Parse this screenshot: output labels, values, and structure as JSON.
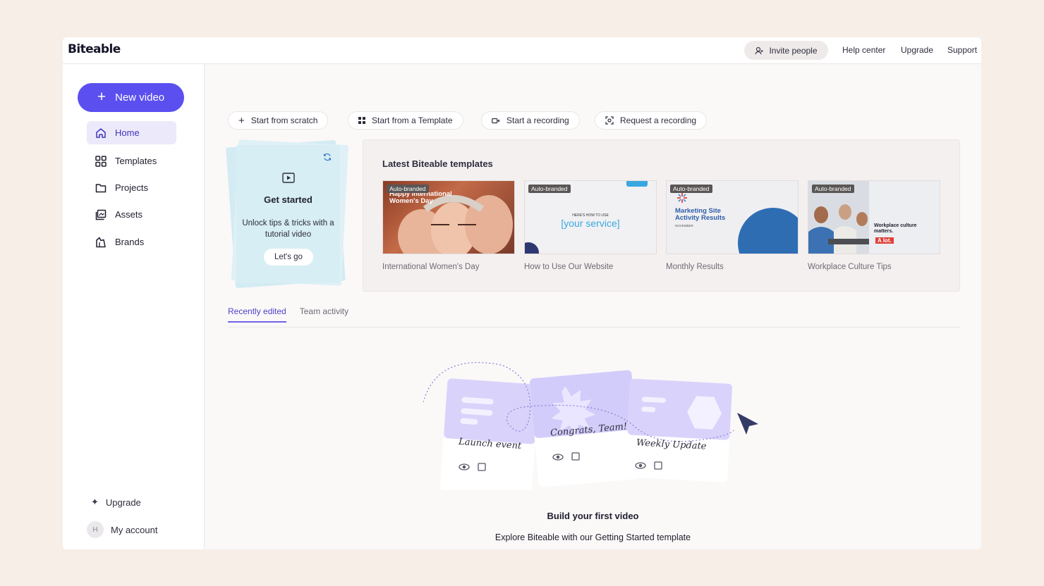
{
  "app": {
    "logo": "Biteable",
    "colors": {
      "accent": "#5b4ff0",
      "background": "#f7eee8"
    }
  },
  "topbar": {
    "invite_label": "Invite people",
    "links": [
      "Help center",
      "Upgrade",
      "Support"
    ]
  },
  "sidebar": {
    "new_video_label": "New video",
    "items": [
      {
        "label": "Home",
        "icon": "home-icon",
        "active": true
      },
      {
        "label": "Templates",
        "icon": "grid-icon",
        "active": false
      },
      {
        "label": "Projects",
        "icon": "folder-icon",
        "active": false
      },
      {
        "label": "Assets",
        "icon": "assets-icon",
        "active": false
      },
      {
        "label": "Brands",
        "icon": "brands-icon",
        "active": false
      }
    ],
    "upgrade_label": "Upgrade",
    "account_label": "My account",
    "avatar_initial": "H"
  },
  "start_actions": [
    {
      "label": "Start from scratch",
      "icon": "plus-icon"
    },
    {
      "label": "Start from a Template",
      "icon": "grid-icon"
    },
    {
      "label": "Start a recording",
      "icon": "camera-icon"
    },
    {
      "label": "Request a recording",
      "icon": "request-recording-icon"
    }
  ],
  "get_started": {
    "title": "Get started",
    "description": "Unlock tips & tricks with a tutorial video",
    "button": "Let's go"
  },
  "latest_templates": {
    "heading": "Latest Biteable templates",
    "badge": "Auto-branded",
    "items": [
      {
        "name": "International Women's Day",
        "thumb_text": "Happy International Women's Day"
      },
      {
        "name": "How to Use Our Website",
        "thumb_small": "HERE'S HOW TO USE",
        "thumb_text": "[your service]"
      },
      {
        "name": "Monthly Results",
        "thumb_text": "Marketing Site Activity Results",
        "thumb_small": "NOVEMBER"
      },
      {
        "name": "Workplace Culture Tips",
        "thumb_text": "Workplace culture matters.",
        "thumb_tag": "A lot."
      }
    ]
  },
  "tabs": [
    {
      "label": "Recently edited",
      "active": true
    },
    {
      "label": "Team activity",
      "active": false
    }
  ],
  "empty_state": {
    "cards": [
      "Launch event",
      "Congrats, Team!",
      "Weekly Update"
    ],
    "title": "Build your first video",
    "subtitle": "Explore Biteable with our Getting Started template"
  }
}
